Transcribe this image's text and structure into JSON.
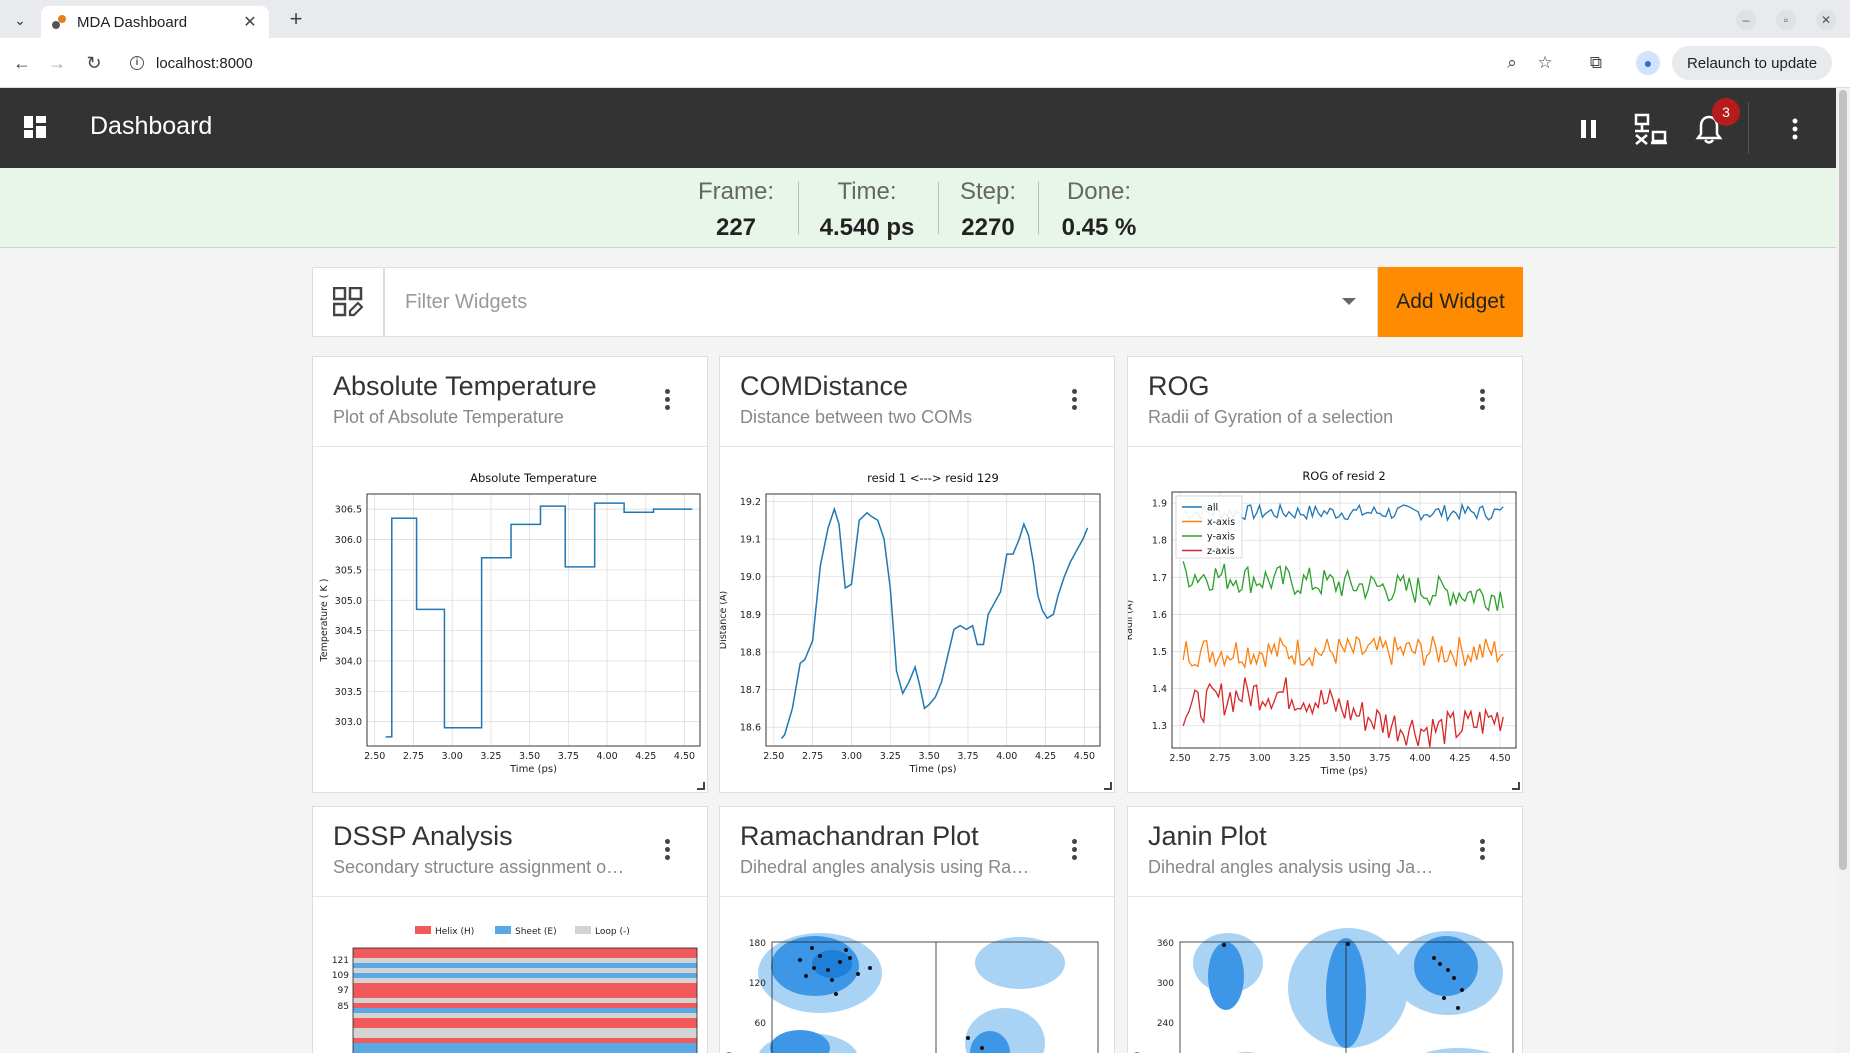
{
  "browser": {
    "tab_title": "MDA Dashboard",
    "url": "localhost:8000",
    "relaunch_label": "Relaunch to update"
  },
  "app": {
    "title": "Dashboard",
    "notification_count": "3"
  },
  "status": {
    "frame_label": "Frame:",
    "frame_value": "227",
    "time_label": "Time:",
    "time_value": "4.540 ps",
    "step_label": "Step:",
    "step_value": "2270",
    "done_label": "Done:",
    "done_value": "0.45 %"
  },
  "filter": {
    "placeholder": "Filter Widgets",
    "add_label": "Add Widget"
  },
  "widgets": [
    {
      "title": "Absolute Temperature",
      "subtitle": "Plot of Absolute Temperature"
    },
    {
      "title": "COMDistance",
      "subtitle": "Distance between two COMs"
    },
    {
      "title": "ROG",
      "subtitle": "Radii of Gyration of a selection"
    },
    {
      "title": "DSSP Analysis",
      "subtitle": "Secondary structure assignment o…"
    },
    {
      "title": "Ramachandran Plot",
      "subtitle": "Dihedral angles analysis using Ra…"
    },
    {
      "title": "Janin Plot",
      "subtitle": "Dihedral angles analysis using Ja…"
    }
  ],
  "chart_data": [
    {
      "type": "line",
      "title": "Absolute Temperature",
      "xlabel": "Time (ps)",
      "ylabel": "Temperature ( K )",
      "xlim": [
        2.45,
        4.6
      ],
      "ylim": [
        302.6,
        306.75
      ],
      "xticks": [
        "2.50",
        "2.75",
        "3.00",
        "3.25",
        "3.50",
        "3.75",
        "4.00",
        "4.25",
        "4.50"
      ],
      "yticks": [
        "303.0",
        "303.5",
        "304.0",
        "304.5",
        "305.0",
        "305.5",
        "306.0",
        "306.5"
      ],
      "grid": true,
      "series": [
        {
          "x": [
            2.57,
            2.59,
            2.61,
            2.61,
            2.77,
            2.77,
            2.95,
            2.95,
            3.14,
            3.14,
            3.19,
            3.19,
            3.38,
            3.38,
            3.57,
            3.57,
            3.73,
            3.73,
            3.92,
            3.92,
            4.11,
            4.11,
            4.3,
            4.3,
            4.55
          ],
          "y": [
            302.75,
            302.75,
            302.75,
            306.35,
            306.35,
            304.85,
            304.85,
            302.9,
            302.9,
            302.9,
            302.9,
            305.7,
            305.7,
            306.25,
            306.25,
            306.55,
            306.55,
            305.55,
            305.55,
            306.6,
            306.6,
            306.45,
            306.45,
            306.5,
            306.5
          ],
          "color": "#1f77b4"
        }
      ]
    },
    {
      "type": "line",
      "title": "resid 1 <---> resid 129",
      "xlabel": "Time (ps)",
      "ylabel": "Distance (Å)",
      "xlim": [
        2.45,
        4.6
      ],
      "ylim": [
        18.55,
        19.22
      ],
      "xticks": [
        "2.50",
        "2.75",
        "3.00",
        "3.25",
        "3.50",
        "3.75",
        "4.00",
        "4.25",
        "4.50"
      ],
      "yticks": [
        "18.6",
        "18.7",
        "18.8",
        "18.9",
        "19.0",
        "19.1",
        "19.2"
      ],
      "grid": true,
      "series": [
        {
          "x": [
            2.55,
            2.57,
            2.62,
            2.67,
            2.7,
            2.75,
            2.8,
            2.85,
            2.89,
            2.92,
            2.96,
            3.0,
            3.05,
            3.1,
            3.13,
            3.17,
            3.21,
            3.25,
            3.29,
            3.33,
            3.37,
            3.41,
            3.44,
            3.47,
            3.5,
            3.54,
            3.58,
            3.62,
            3.66,
            3.7,
            3.74,
            3.78,
            3.81,
            3.85,
            3.88,
            3.92,
            3.96,
            4.0,
            4.04,
            4.08,
            4.11,
            4.14,
            4.17,
            4.2,
            4.23,
            4.26,
            4.3,
            4.33,
            4.37,
            4.41,
            4.45,
            4.49,
            4.52
          ],
          "y": [
            18.57,
            18.58,
            18.65,
            18.77,
            18.78,
            18.83,
            19.03,
            19.13,
            19.18,
            19.14,
            18.97,
            18.98,
            19.15,
            19.17,
            19.16,
            19.15,
            19.1,
            18.97,
            18.75,
            18.69,
            18.72,
            18.76,
            18.71,
            18.65,
            18.66,
            18.68,
            18.72,
            18.79,
            18.86,
            18.87,
            18.86,
            18.87,
            18.82,
            18.82,
            18.9,
            18.93,
            18.96,
            19.06,
            19.06,
            19.1,
            19.14,
            19.11,
            19.04,
            18.95,
            18.91,
            18.89,
            18.9,
            18.95,
            19.0,
            19.04,
            19.07,
            19.1,
            19.13
          ],
          "color": "#1f77b4"
        }
      ]
    },
    {
      "type": "line",
      "title": "ROG of resid 2",
      "xlabel": "Time (ps)",
      "ylabel": "Radii (Å)",
      "xlim": [
        2.45,
        4.6
      ],
      "ylim": [
        1.24,
        1.93
      ],
      "xticks": [
        "2.50",
        "2.75",
        "3.00",
        "3.25",
        "3.50",
        "3.75",
        "4.00",
        "4.25",
        "4.50"
      ],
      "yticks": [
        "1.3",
        "1.4",
        "1.5",
        "1.6",
        "1.7",
        "1.8",
        "1.9"
      ],
      "grid": true,
      "legend": "top-left",
      "series": [
        {
          "name": "all",
          "color": "#1f77b4",
          "base": 1.875,
          "amp": 0.03
        },
        {
          "name": "x-axis",
          "color": "#ff7f0e",
          "base": 1.5,
          "amp": 0.06
        },
        {
          "name": "y-axis",
          "color": "#2ca02c",
          "base": 1.71,
          "amp": 0.06
        },
        {
          "name": "z-axis",
          "color": "#d62728",
          "base": 1.34,
          "amp": 0.07
        }
      ]
    },
    {
      "type": "heatmap",
      "legend": [
        "Helix (H)",
        "Sheet (E)",
        "Loop (-)"
      ],
      "legend_colors": [
        "#f05a5a",
        "#5aa8e6",
        "#d3d3d3"
      ],
      "yticks": [
        "121",
        "109",
        "97",
        "85"
      ]
    },
    {
      "type": "scatter",
      "yticks": [
        "180",
        "120",
        "60"
      ],
      "ylabel": "rees)"
    },
    {
      "type": "scatter",
      "yticks": [
        "360",
        "300",
        "240"
      ],
      "ylabel": "rees)"
    }
  ]
}
